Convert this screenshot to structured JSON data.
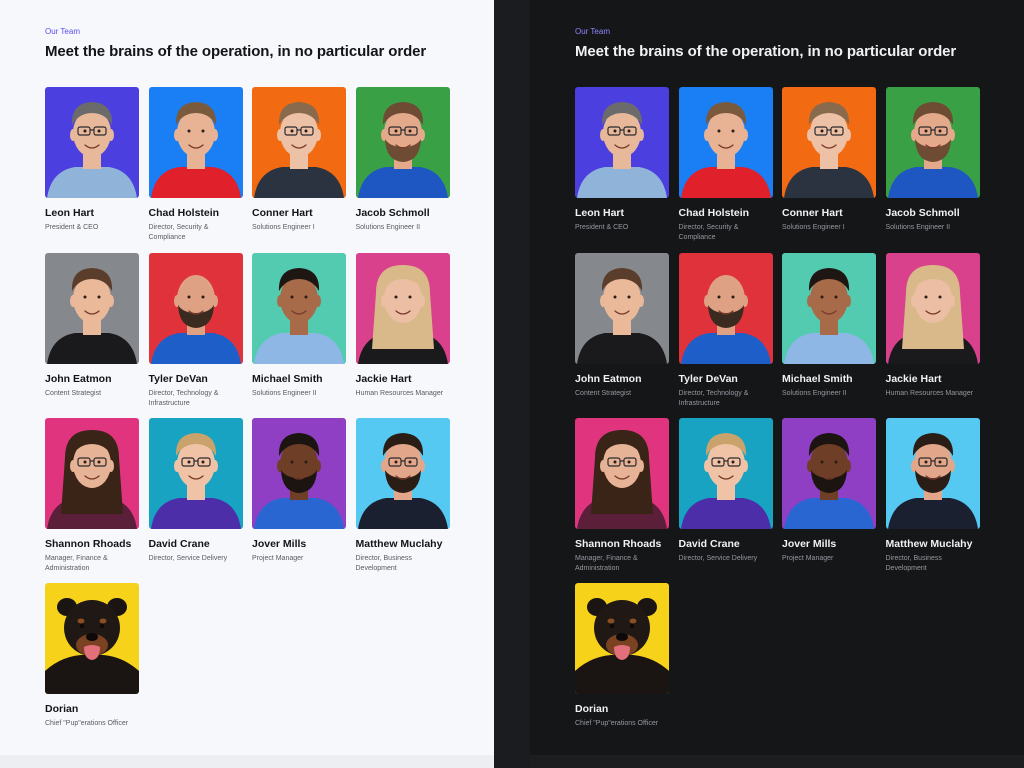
{
  "section": {
    "eyebrow": "Our Team",
    "title": "Meet the brains of the operation, in no particular order"
  },
  "members": [
    {
      "name": "Leon Hart",
      "role": "President & CEO",
      "bg": "#4b3fe0",
      "hair": "#6b6b6b",
      "skin": "#e7b89a",
      "shirt": "#8fb3d9",
      "glasses": true,
      "beard": false
    },
    {
      "name": "Chad Holstein",
      "role": "Director, Security & Compliance",
      "bg": "#1a7ef5",
      "hair": "#7a5a3c",
      "skin": "#e8b394",
      "shirt": "#e0202a",
      "glasses": false,
      "beard": false
    },
    {
      "name": "Conner Hart",
      "role": "Solutions Engineer I",
      "bg": "#f26a12",
      "hair": "#8a6a4c",
      "skin": "#edc1a5",
      "shirt": "#2c3340",
      "glasses": true,
      "beard": false
    },
    {
      "name": "Jacob Schmoll",
      "role": "Solutions Engineer II",
      "bg": "#3aa046",
      "hair": "#6e4b33",
      "skin": "#e3a98a",
      "shirt": "#1e56c2",
      "glasses": true,
      "beard": true
    },
    {
      "name": "John Eatmon",
      "role": "Content Strategist",
      "bg": "#85888d",
      "hair": "#5a3d2a",
      "skin": "#e9b99a",
      "shirt": "#1a1a1c",
      "glasses": false,
      "beard": false
    },
    {
      "name": "Tyler DeVan",
      "role": "Director, Technology & Infrastructure",
      "bg": "#e0323a",
      "hair": "#d9a889",
      "skin": "#dea183",
      "shirt": "#1e5ec9",
      "glasses": false,
      "beard": true
    },
    {
      "name": "Michael Smith",
      "role": "Solutions Engineer II",
      "bg": "#52cbb0",
      "hair": "#1d1612",
      "skin": "#a86b49",
      "shirt": "#8fb7e6",
      "glasses": false,
      "beard": false
    },
    {
      "name": "Jackie Hart",
      "role": "Human Resources Manager",
      "bg": "#d9418c",
      "hair": "#d9b98a",
      "skin": "#ecbea3",
      "shirt": "#1a1a1c",
      "glasses": false,
      "beard": false
    },
    {
      "name": "Shannon Rhoads",
      "role": "Manager, Finance & Administration",
      "bg": "#e0347f",
      "hair": "#3a2418",
      "skin": "#e7b396",
      "shirt": "#5b1f3a",
      "glasses": true,
      "beard": false
    },
    {
      "name": "David Crane",
      "role": "Director, Service Delivery",
      "bg": "#19a3c2",
      "hair": "#c9a36b",
      "skin": "#f0c3a6",
      "shirt": "#4b2ea8",
      "glasses": true,
      "beard": false
    },
    {
      "name": "Jover Mills",
      "role": "Project Manager",
      "bg": "#8f3fc4",
      "hair": "#1c1410",
      "skin": "#6e3f26",
      "shirt": "#2a66d1",
      "glasses": false,
      "beard": true
    },
    {
      "name": "Matthew Muclahy",
      "role": "Director, Business Development",
      "bg": "#56c9f2",
      "hair": "#2a1d16",
      "skin": "#e2a78a",
      "shirt": "#1b2030",
      "glasses": true,
      "beard": true
    },
    {
      "name": "Dorian",
      "role": "Chief \"Pup\"erations Officer",
      "bg": "#f7d21a",
      "hair": "#1a1412",
      "skin": "#1a1412",
      "shirt": "#1a1412",
      "glasses": false,
      "beard": false,
      "dog": true
    }
  ]
}
